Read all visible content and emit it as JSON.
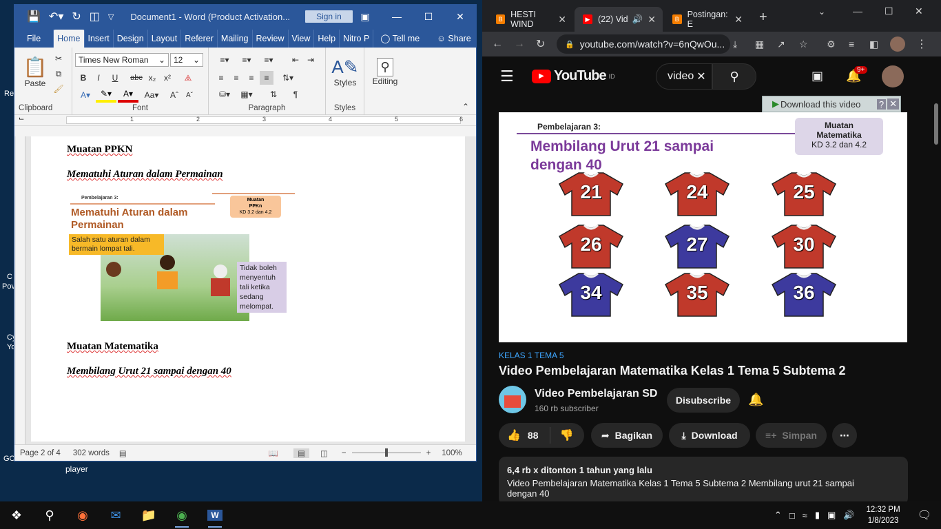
{
  "desktop": {
    "labels": [
      "Re",
      "C",
      "Pov",
      "Cy",
      "Yo",
      "GO",
      "player"
    ]
  },
  "word": {
    "title": "Document1  -  Word (Product Activation...",
    "sign_in": "Sign in",
    "tabs": [
      "File",
      "Home",
      "Insert",
      "Design",
      "Layout",
      "Referer",
      "Mailing",
      "Review",
      "View",
      "Help",
      "Nitro P",
      "Tell me",
      "Share"
    ],
    "font_name": "Times New Roman",
    "font_size": "12",
    "groups": {
      "clipboard": "Clipboard",
      "font": "Font",
      "paragraph": "Paragraph",
      "styles": "Styles"
    },
    "paste": "Paste",
    "styles_btn": "Styles",
    "editing": "Editing",
    "ruler_nums": [
      "1",
      "2",
      "3",
      "4",
      "5",
      "6"
    ],
    "doc": {
      "h1": "Muatan PPKN",
      "s1": "Mematuhi Aturan dalam Permainan",
      "h2": "Muatan Matematika",
      "s2": "Membilang Urut 21 sampai dengan 40",
      "img": {
        "pembelajaran": "Pembelajaran 3:",
        "title1": "Mematuhi Aturan dalam",
        "title2": "Permainan",
        "badge1": "Muatan",
        "badge2": "PPKn",
        "badge3": "KD 3.2 dan 4.2",
        "note1": "Salah satu aturan dalam",
        "note2": "bermain lompat tali.",
        "bubble": [
          "Tidak boleh",
          "menyentuh",
          "tali ketika",
          "sedang",
          "melompat."
        ]
      }
    },
    "status": {
      "page": "Page 2 of 4",
      "words": "302 words",
      "zoom": "100%"
    }
  },
  "chrome": {
    "tabs": [
      {
        "label": "HESTI WIND"
      },
      {
        "label": "(22) Vid"
      },
      {
        "label": "Postingan: E"
      }
    ],
    "url": "youtube.com/watch?v=6nQwOu..."
  },
  "youtube": {
    "logo": "YouTube",
    "logo_sup": "ID",
    "search": "video",
    "notif": "9+",
    "download_bar": "Download this video",
    "video": {
      "pembelajaran": "Pembelajaran 3:",
      "title1": "Membilang Urut  21 sampai",
      "title2": "dengan 40",
      "badge1": "Muatan",
      "badge2": "Matematika",
      "badge3": "KD 3.2 dan 4.2",
      "shirts": [
        {
          "n": "21",
          "c": "#c0392b"
        },
        {
          "n": "24",
          "c": "#c0392b"
        },
        {
          "n": "25",
          "c": "#c0392b"
        },
        {
          "n": "26",
          "c": "#c0392b"
        },
        {
          "n": "27",
          "c": "#3d3a9e"
        },
        {
          "n": "30",
          "c": "#c0392b"
        },
        {
          "n": "34",
          "c": "#3d3a9e"
        },
        {
          "n": "35",
          "c": "#c0392b"
        },
        {
          "n": "36",
          "c": "#3d3a9e"
        }
      ]
    },
    "hashtag": "KELAS 1 TEMA 5",
    "title": "Video Pembelajaran Matematika Kelas 1 Tema 5 Subtema 2",
    "channel": "Video Pembelajaran SD",
    "subs": "160 rb subscriber",
    "subscribe": "Disubscribe",
    "likes": "88",
    "share": "Bagikan",
    "download": "Download",
    "save": "Simpan",
    "views": "6,4 rb x ditonton  1 tahun yang lalu",
    "desc1": "Video Pembelajaran Matematika Kelas 1 Tema 5 Subtema 2 Membilang urut 21 sampai",
    "desc2": "dengan 40"
  },
  "taskbar": {
    "time": "12:32 PM",
    "date": "1/8/2023"
  }
}
